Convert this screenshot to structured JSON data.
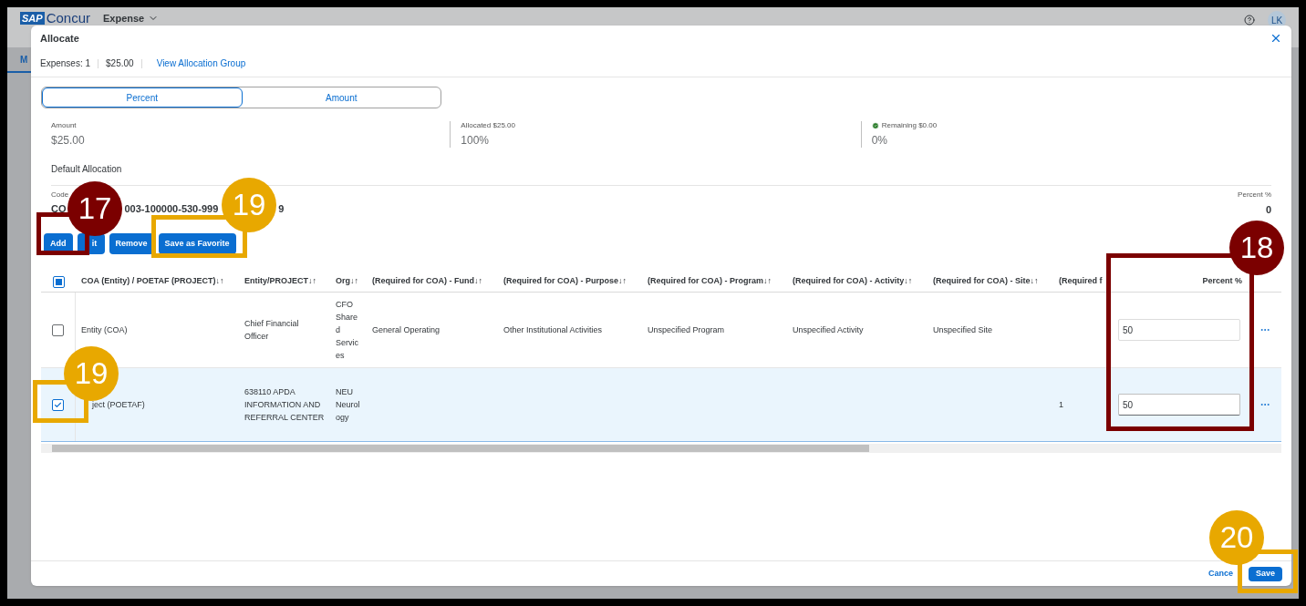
{
  "app_bar": {
    "logo_mark": "SAP",
    "logo_text": "Concur",
    "menu": "Expense",
    "avatar": "LK",
    "tab": "M"
  },
  "dialog": {
    "title": "Allocate",
    "meta": [
      "Expenses: 1",
      "$25.00"
    ],
    "link": "View Allocation Group",
    "modes": [
      {
        "label": "Percent",
        "selected": true
      },
      {
        "label": "Amount",
        "selected": false
      }
    ],
    "summary": [
      {
        "label": "Amount",
        "value": "$25.00",
        "ok": false
      },
      {
        "label": "Allocated $25.00",
        "value": "100%",
        "ok": false
      },
      {
        "label": "Remaining $0.00",
        "value": "0%",
        "ok": true
      }
    ],
    "default_label": "Default Allocation",
    "code": {
      "label": "Code",
      "parts": [
        "CO",
        "003-100000-530-999",
        "9"
      ]
    },
    "percent_total": {
      "label": "Percent %",
      "value": "0"
    },
    "buttons": [
      "Add",
      "it",
      "Remove",
      "Save as Favorite"
    ],
    "table": {
      "select_all": {
        "indeterminate": true
      },
      "columns": [
        "COA (Entity) / POETAF (PROJECT)↓↑",
        "Entity/PROJECT↓↑",
        "Org↓↑",
        "(Required for COA) - Fund↓↑",
        "(Required for COA) - Purpose↓↑",
        "(Required for COA) - Program↓↑",
        "(Required for COA) - Activity↓↑",
        "(Required for COA) - Site↓↑",
        "(Required f",
        "Percent %"
      ],
      "rows": [
        {
          "selected": false,
          "checked": false,
          "cells": [
            "Entity (COA)",
            "Chief Financial Officer",
            "CFO Shared Services",
            "General Operating",
            "Other Institutional Activities",
            "Unspecified Program",
            "Unspecified Activity",
            "Unspecified Site",
            null
          ],
          "percent": "50"
        },
        {
          "selected": true,
          "checked": true,
          "cells": [
            "ject (POETAF)",
            "638110 APDA INFORMATION AND REFERRAL CENTER",
            "NEU Neurology",
            null,
            null,
            null,
            null,
            null,
            "1"
          ],
          "percent": "50"
        }
      ]
    },
    "footer": {
      "cancel": "Cance",
      "save": "Save"
    }
  },
  "annotations": [
    {
      "number": "17",
      "color": "#7b0000"
    },
    {
      "number": "19",
      "color": "#e8a800"
    },
    {
      "number": "18",
      "color": "#7b0000"
    },
    {
      "number": "19",
      "color": "#e8a800"
    },
    {
      "number": "20",
      "color": "#e8a800"
    }
  ]
}
